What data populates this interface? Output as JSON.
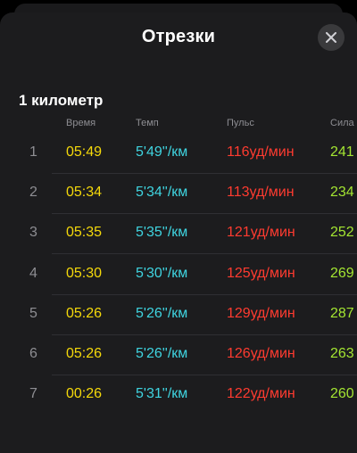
{
  "sheet": {
    "title": "Отрезки",
    "close_icon": "close-icon"
  },
  "section": {
    "title": "1 километр"
  },
  "columns": {
    "time": "Время",
    "pace": "Темп",
    "heart_rate": "Пульс",
    "power": "Сила"
  },
  "colors": {
    "background": "#000000",
    "sheet": "#1c1c1e",
    "time": "#f5d90a",
    "pace": "#3fd4e0",
    "heart_rate": "#ff3b30",
    "power": "#a4e632",
    "muted": "#8e8e93"
  },
  "rows": [
    {
      "index": "1",
      "time": "05:49",
      "pace": "5'49''/км",
      "heart_rate": "116уд/мин",
      "power": "241"
    },
    {
      "index": "2",
      "time": "05:34",
      "pace": "5'34''/км",
      "heart_rate": "113уд/мин",
      "power": "234"
    },
    {
      "index": "3",
      "time": "05:35",
      "pace": "5'35''/км",
      "heart_rate": "121уд/мин",
      "power": "252"
    },
    {
      "index": "4",
      "time": "05:30",
      "pace": "5'30''/км",
      "heart_rate": "125уд/мин",
      "power": "269"
    },
    {
      "index": "5",
      "time": "05:26",
      "pace": "5'26''/км",
      "heart_rate": "129уд/мин",
      "power": "287"
    },
    {
      "index": "6",
      "time": "05:26",
      "pace": "5'26''/км",
      "heart_rate": "126уд/мин",
      "power": "263"
    },
    {
      "index": "7",
      "time": "00:26",
      "pace": "5'31''/км",
      "heart_rate": "122уд/мин",
      "power": "260"
    }
  ]
}
